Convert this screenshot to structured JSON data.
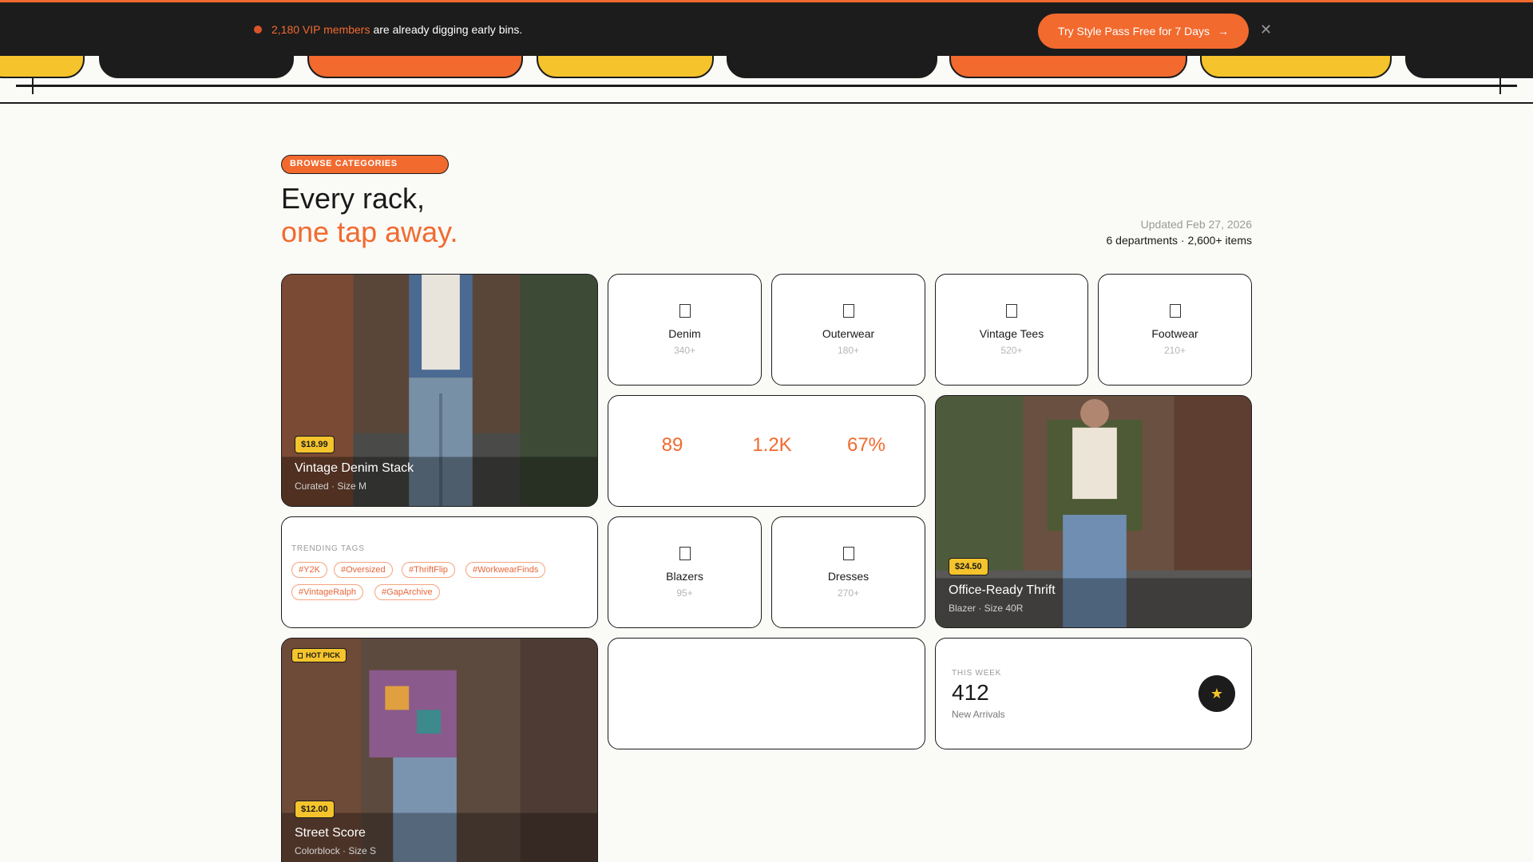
{
  "announcement": {
    "vip_count": "2,180 VIP members",
    "text": "are already digging early bins.",
    "cta_label": "Try Style Pass Free for 7 Days",
    "arrow_icon": "→",
    "close_icon": "✕"
  },
  "colors": {
    "accent": "#f26a2e",
    "yellow": "#f5c42c",
    "dark": "#1c1c1c",
    "background": "#fafaf7"
  },
  "section": {
    "badge": "BROWSE CATEGORIES",
    "title_line1": "Every rack,",
    "title_line2": "one tap away.",
    "updated": "Updated Feb 27, 2026",
    "meta": "6 departments · 2,600+ items"
  },
  "categories": [
    {
      "name": "Denim",
      "count": "340+",
      "icon": "denim-icon"
    },
    {
      "name": "Outerwear",
      "count": "180+",
      "icon": "outerwear-icon"
    },
    {
      "name": "Vintage Tees",
      "count": "520+",
      "icon": "tee-icon"
    },
    {
      "name": "Footwear",
      "count": "210+",
      "icon": "footwear-icon"
    },
    {
      "name": "Blazers",
      "count": "95+",
      "icon": "blazer-icon"
    },
    {
      "name": "Dresses",
      "count": "270+",
      "icon": "dress-icon"
    }
  ],
  "stats": [
    "89",
    "1.2K",
    "67%"
  ],
  "products": [
    {
      "price": "$18.99",
      "title": "Vintage Denim Stack",
      "sub": "Curated · Size M"
    },
    {
      "price": "$24.50",
      "title": "Office-Ready Thrift",
      "sub": "Blazer · Size 40R"
    },
    {
      "price": "$12.00",
      "title": "Street Score",
      "sub": "Colorblock · Size S",
      "badge": "HOT PICK"
    }
  ],
  "trending": {
    "label": "TRENDING TAGS",
    "tags": [
      "#Y2K",
      "#Oversized",
      "#ThriftFlip",
      "#WorkwearFinds",
      "#VintageRalph",
      "#GapArchive"
    ]
  },
  "week": {
    "label": "THIS WEEK",
    "value": "412",
    "sub": "New Arrivals",
    "icon": "★"
  }
}
